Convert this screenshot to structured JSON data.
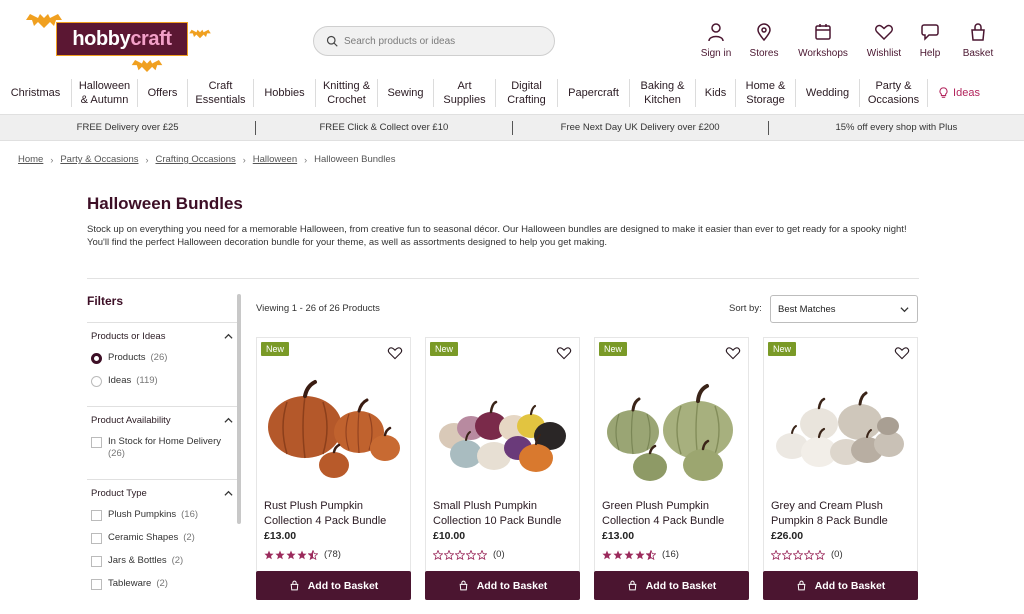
{
  "brand": {
    "logo_text_1": "hobby",
    "logo_text_2": "craft"
  },
  "search": {
    "placeholder": "Search products or ideas"
  },
  "header_actions": [
    {
      "label": "Sign in",
      "icon": "user-icon"
    },
    {
      "label": "Stores",
      "icon": "location-pin-icon"
    },
    {
      "label": "Workshops",
      "icon": "calendar-icon"
    },
    {
      "label": "Wishlist",
      "icon": "heart-icon"
    },
    {
      "label": "Help",
      "icon": "chat-bubble-icon"
    },
    {
      "label": "Basket",
      "icon": "basket-icon"
    }
  ],
  "nav": [
    {
      "label": "Christmas"
    },
    {
      "label": "Halloween & Autumn",
      "l1": "Halloween",
      "l2": "& Autumn"
    },
    {
      "label": "Offers"
    },
    {
      "label": "Craft Essentials",
      "l1": "Craft",
      "l2": "Essentials"
    },
    {
      "label": "Hobbies"
    },
    {
      "label": "Knitting & Crochet",
      "l1": "Knitting &",
      "l2": "Crochet"
    },
    {
      "label": "Sewing"
    },
    {
      "label": "Art Supplies",
      "l1": "Art",
      "l2": "Supplies"
    },
    {
      "label": "Digital Crafting",
      "l1": "Digital",
      "l2": "Crafting"
    },
    {
      "label": "Papercraft"
    },
    {
      "label": "Baking & Kitchen",
      "l1": "Baking &",
      "l2": "Kitchen"
    },
    {
      "label": "Kids"
    },
    {
      "label": "Home & Storage",
      "l1": "Home &",
      "l2": "Storage"
    },
    {
      "label": "Wedding"
    },
    {
      "label": "Party & Occasions",
      "l1": "Party &",
      "l2": "Occasions"
    },
    {
      "label": "Ideas",
      "icon": "bulb-icon"
    }
  ],
  "promo": [
    "FREE Delivery over £25",
    "FREE Click & Collect over £10",
    "Free Next Day UK Delivery over £200",
    "15% off every shop with Plus"
  ],
  "breadcrumb": {
    "home": "Home",
    "party": "Party & Occasions",
    "crafting": "Crafting Occasions",
    "halloween": "Halloween",
    "current": "Halloween Bundles"
  },
  "page": {
    "title": "Halloween Bundles",
    "description": "Stock up on everything you need for a memorable Halloween, from creative fun to seasonal décor. Our Halloween bundles are designed to make it easier than ever to get ready for a spooky night! You'll find the perfect Halloween decoration bundle for your theme, as well as assortments designed to help you get making."
  },
  "filters": {
    "title": "Filters",
    "groups": [
      {
        "title": "Products or Ideas",
        "options": [
          {
            "label": "Products",
            "count": "(26)",
            "selected": true
          },
          {
            "label": "Ideas",
            "count": "(119)",
            "selected": false
          }
        ]
      },
      {
        "title": "Product Availability",
        "options": [
          {
            "label": "In Stock for Home Delivery",
            "count": "(26)"
          }
        ]
      },
      {
        "title": "Product Type",
        "options": [
          {
            "label": "Plush Pumpkins",
            "count": "(16)"
          },
          {
            "label": "Ceramic Shapes",
            "count": "(2)"
          },
          {
            "label": "Jars & Bottles",
            "count": "(2)"
          },
          {
            "label": "Tableware",
            "count": "(2)"
          }
        ]
      }
    ]
  },
  "listing": {
    "viewing": "Viewing 1 - 26 of 26 Products",
    "sort_label": "Sort by:",
    "sort_value": "Best Matches"
  },
  "products": [
    {
      "badge": "New",
      "name": "Rust Plush Pumpkin Collection 4 Pack Bundle",
      "price": "£13.00",
      "rating": 4.5,
      "reviews": "(78)",
      "cta": "Add to Basket"
    },
    {
      "badge": "New",
      "name": "Small Plush Pumpkin Collection 10 Pack Bundle",
      "price": "£10.00",
      "rating": 0,
      "reviews": "(0)",
      "cta": "Add to Basket"
    },
    {
      "badge": "New",
      "name": "Green Plush Pumpkin Collection 4 Pack Bundle",
      "price": "£13.00",
      "rating": 4.5,
      "reviews": "(16)",
      "cta": "Add to Basket"
    },
    {
      "badge": "New",
      "name": "Grey and Cream Plush Pumpkin 8 Pack Bundle",
      "price": "£26.00",
      "rating": 0,
      "reviews": "(0)",
      "cta": "Add to Basket"
    }
  ],
  "colors": {
    "brand_plum": "#4b1530",
    "badge_green": "#7a9a27",
    "star": "#9b2a5c",
    "logo_bg": "#5b1733",
    "bat_orange": "#f0a020"
  }
}
